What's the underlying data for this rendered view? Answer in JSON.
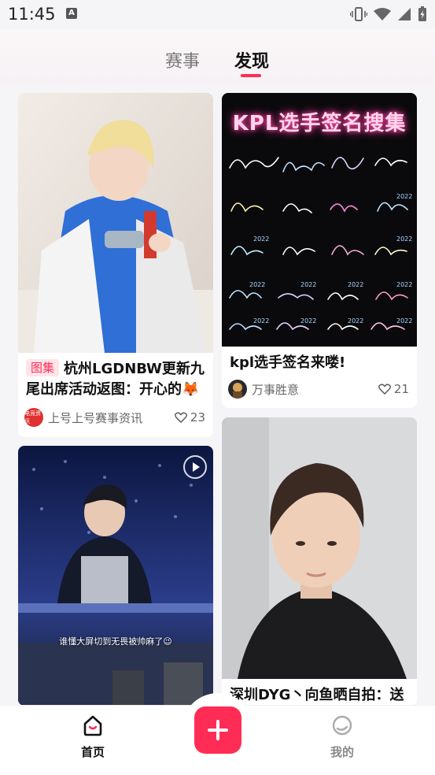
{
  "status": {
    "time": "11:45",
    "notif_letter": "A"
  },
  "tabs": [
    {
      "label": "赛事"
    },
    {
      "label": "发现"
    }
  ],
  "feed": {
    "card1": {
      "tag": "图集",
      "title_line1": "杭州LGDNBW更新九",
      "title_line2": "尾出席活动返图：开心的🦊",
      "author": "上号上号赛事资讯",
      "author_avatar_text": "电竞资讯",
      "likes": "23"
    },
    "card2": {
      "poster_title": "KPL选手签名搜集",
      "poster_years": [
        "2022",
        "2022",
        "2022",
        "2022",
        "2022",
        "2022",
        "2022",
        "2022",
        "2022",
        "2022",
        "2022"
      ],
      "title": "kpl选手签名来喽!",
      "author": "万事胜意",
      "likes": "21"
    },
    "card3": {
      "overlay_text": "谁懂大屏切到无畏被帅麻了😉"
    },
    "card4": {
      "title": "深圳DYG丶向鱼晒自拍：送"
    }
  },
  "bottom_nav": {
    "home": "首页",
    "mine": "我的"
  },
  "colors": {
    "accent": "#ff2d55"
  }
}
